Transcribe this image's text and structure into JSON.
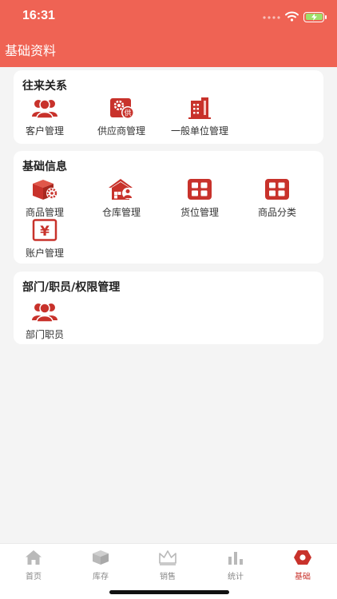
{
  "status_bar": {
    "time": "16:31"
  },
  "nav": {
    "title": "基础资料"
  },
  "colors": {
    "header": "#ef6354",
    "icon": "#c8322b",
    "tab_active": "#c8322b"
  },
  "sections": [
    {
      "title": "往来关系",
      "items": [
        {
          "label": "客户管理",
          "icon": "people-icon"
        },
        {
          "label": "供应商管理",
          "icon": "supplier-icon",
          "badge": "供"
        },
        {
          "label": "一般单位管理",
          "icon": "building-icon"
        }
      ]
    },
    {
      "title": "基础信息",
      "items": [
        {
          "label": "商品管理",
          "icon": "box-gear-icon"
        },
        {
          "label": "仓库管理",
          "icon": "warehouse-icon"
        },
        {
          "label": "货位管理",
          "icon": "grid-icon"
        },
        {
          "label": "商品分类",
          "icon": "grid-icon"
        },
        {
          "label": "账户管理",
          "icon": "yuan-icon",
          "symbol": "¥"
        }
      ]
    },
    {
      "title": "部门/职员/权限管理",
      "items": [
        {
          "label": "部门职员",
          "icon": "people-icon"
        }
      ]
    }
  ],
  "tabs": [
    {
      "label": "首页",
      "icon": "home-icon"
    },
    {
      "label": "库存",
      "icon": "inventory-icon"
    },
    {
      "label": "销售",
      "icon": "crown-icon"
    },
    {
      "label": "统计",
      "icon": "stats-icon"
    },
    {
      "label": "基础",
      "icon": "hexagon-icon",
      "active": true
    }
  ]
}
